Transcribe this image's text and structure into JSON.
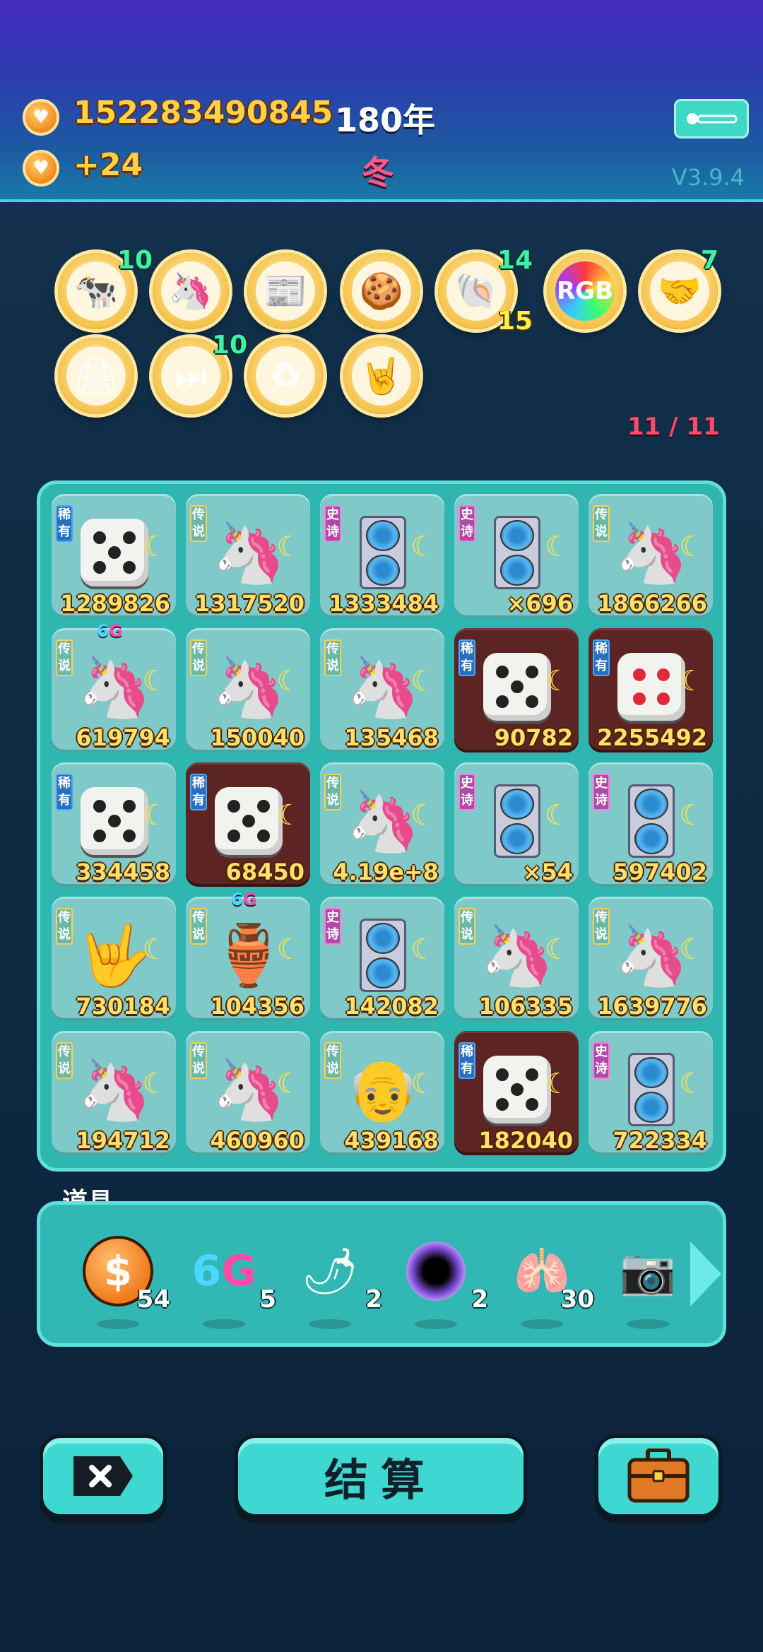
{
  "header": {
    "coins": "152283490845",
    "year": "180年",
    "income": "+24",
    "season": "冬",
    "version": "V3.9.4"
  },
  "relics": [
    {
      "name": "twin-cows-icon",
      "badge": "10",
      "badge2": ""
    },
    {
      "name": "unicorn-icon",
      "badge": "",
      "badge2": ""
    },
    {
      "name": "time-magazine-icon",
      "badge": "",
      "badge2": ""
    },
    {
      "name": "mooncake-icon",
      "badge": "",
      "badge2": ""
    },
    {
      "name": "seashell-icon",
      "badge": "14",
      "badge2": "15"
    },
    {
      "name": "rgb-icon",
      "label": "RGB",
      "badge": "",
      "badge2": ""
    },
    {
      "name": "handshake-icon",
      "badge": "7",
      "badge2": ""
    },
    {
      "name": "printer-icon",
      "badge": "",
      "badge2": ""
    },
    {
      "name": "skip-icon",
      "badge": "10",
      "badge2": ""
    },
    {
      "name": "recycle-icon",
      "badge": "",
      "badge2": ""
    },
    {
      "name": "rock-hand-icon",
      "badge": "",
      "badge2": ""
    }
  ],
  "counter": "11 / 11",
  "tags": {
    "rare": "稀有",
    "legend": "传说",
    "epic": "史诗"
  },
  "board": [
    {
      "tag": "rare",
      "item": "dice",
      "value": "1289826",
      "dark": false
    },
    {
      "tag": "legend",
      "item": "unicorn",
      "value": "1317520",
      "dark": false
    },
    {
      "tag": "epic",
      "item": "gpu",
      "value": "1333484",
      "dark": false
    },
    {
      "tag": "epic",
      "item": "gpu",
      "value": "×696",
      "dark": false
    },
    {
      "tag": "legend",
      "item": "unicorn",
      "value": "1866266",
      "dark": false
    },
    {
      "tag": "legend",
      "item": "unicorn-crown",
      "value": "619794",
      "dark": false,
      "label": "6G"
    },
    {
      "tag": "legend",
      "item": "unicorn",
      "value": "150040",
      "dark": false
    },
    {
      "tag": "legend",
      "item": "unicorn",
      "value": "135468",
      "dark": false
    },
    {
      "tag": "rare",
      "item": "dice",
      "value": "90782",
      "dark": true
    },
    {
      "tag": "rare",
      "item": "dice-red",
      "value": "2255492",
      "dark": true
    },
    {
      "tag": "rare",
      "item": "dice",
      "value": "334458",
      "dark": false
    },
    {
      "tag": "rare",
      "item": "dice",
      "value": "68450",
      "dark": true
    },
    {
      "tag": "legend",
      "item": "unicorn",
      "value": "4.19e+8",
      "dark": false
    },
    {
      "tag": "epic",
      "item": "gpu",
      "value": "×54",
      "dark": false
    },
    {
      "tag": "epic",
      "item": "gpu",
      "value": "597402",
      "dark": false
    },
    {
      "tag": "legend",
      "item": "rock-hand",
      "value": "730184",
      "dark": false
    },
    {
      "tag": "legend",
      "item": "vase",
      "value": "104356",
      "dark": false,
      "label": "6G"
    },
    {
      "tag": "epic",
      "item": "gpu",
      "value": "142082",
      "dark": false
    },
    {
      "tag": "legend",
      "item": "unicorn",
      "value": "106335",
      "dark": false
    },
    {
      "tag": "legend",
      "item": "unicorn",
      "value": "1639776",
      "dark": false
    },
    {
      "tag": "legend",
      "item": "unicorn",
      "value": "194712",
      "dark": false
    },
    {
      "tag": "legend",
      "item": "unicorn",
      "value": "460960",
      "dark": false
    },
    {
      "tag": "legend",
      "item": "old-man",
      "value": "439168",
      "dark": false
    },
    {
      "tag": "rare",
      "item": "dice",
      "value": "182040",
      "dark": true
    },
    {
      "tag": "epic",
      "item": "gpu",
      "value": "722334",
      "dark": false
    }
  ],
  "props": {
    "title": "道具",
    "items": [
      {
        "name": "dollar-coin-icon",
        "qty": "54"
      },
      {
        "name": "6g-icon",
        "label": "6G",
        "qty": "5"
      },
      {
        "name": "chili-icon",
        "qty": "2"
      },
      {
        "name": "black-hole-icon",
        "qty": "2"
      },
      {
        "name": "liver-icon",
        "qty": "30"
      },
      {
        "name": "camera-icon",
        "qty": ""
      }
    ]
  },
  "buttons": {
    "settle": "结算"
  },
  "colors": {
    "accent": "#3fd8d0",
    "gold": "#ffe06a",
    "panel": "#2fb6b0"
  }
}
